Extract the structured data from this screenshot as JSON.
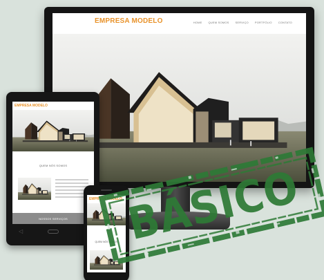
{
  "desktop": {
    "logo": "EMPRESA MODELO",
    "nav": [
      "HOME",
      "QUEM SOMOS",
      "SERVIÇO",
      "PORTFÓLIO",
      "CONTATO"
    ]
  },
  "tablet": {
    "logo": "EMPRESA MODELO",
    "section_title": "QUEM NÓS SOMOS",
    "footer_label": "NOSSOS SERVIÇOS"
  },
  "phone": {
    "logo": "EMPRESA MODELO",
    "section_title": "QUEM NÓS SOMOS"
  },
  "stamp": {
    "label": "BÁSICO"
  },
  "colors": {
    "background": "#d9e2dc",
    "logo_accent": "#e8922a",
    "stamp_green": "#2e7a36"
  }
}
